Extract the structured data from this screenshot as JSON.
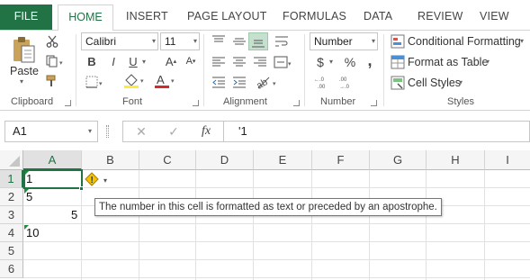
{
  "tabs": [
    "FILE",
    "HOME",
    "INSERT",
    "PAGE LAYOUT",
    "FORMULAS",
    "DATA",
    "REVIEW",
    "VIEW"
  ],
  "ribbon": {
    "clipboard": {
      "paste_label": "Paste",
      "group_label": "Clipboard"
    },
    "font": {
      "font_name": "Calibri",
      "font_size": "11",
      "group_label": "Font",
      "bold": "B",
      "italic": "I",
      "underline": "U"
    },
    "alignment": {
      "group_label": "Alignment"
    },
    "number": {
      "format": "Number",
      "currency": "$",
      "percent": "%",
      "comma": ",",
      "group_label": "Number"
    },
    "styles": {
      "conditional_formatting": "Conditional Formatting",
      "format_as_table": "Format as Table",
      "cell_styles": "Cell Styles",
      "group_label": "Styles"
    }
  },
  "formula_bar": {
    "name_box": "A1",
    "fx": "fx",
    "formula": "'1"
  },
  "grid": {
    "columns": [
      "A",
      "B",
      "C",
      "D",
      "E",
      "F",
      "G",
      "H",
      "I"
    ],
    "rows": [
      "1",
      "2",
      "3",
      "4",
      "5",
      "6"
    ],
    "cells": {
      "A1": "1",
      "A2": "5",
      "A3": "5",
      "A4": "10"
    }
  },
  "error_tooltip": "The number in this cell is formatted as text or preceded by an apostrophe.",
  "colors": {
    "excel_green": "#217346",
    "error_triangle": "#1d8b3a",
    "warning_yellow": "#f5c400"
  }
}
